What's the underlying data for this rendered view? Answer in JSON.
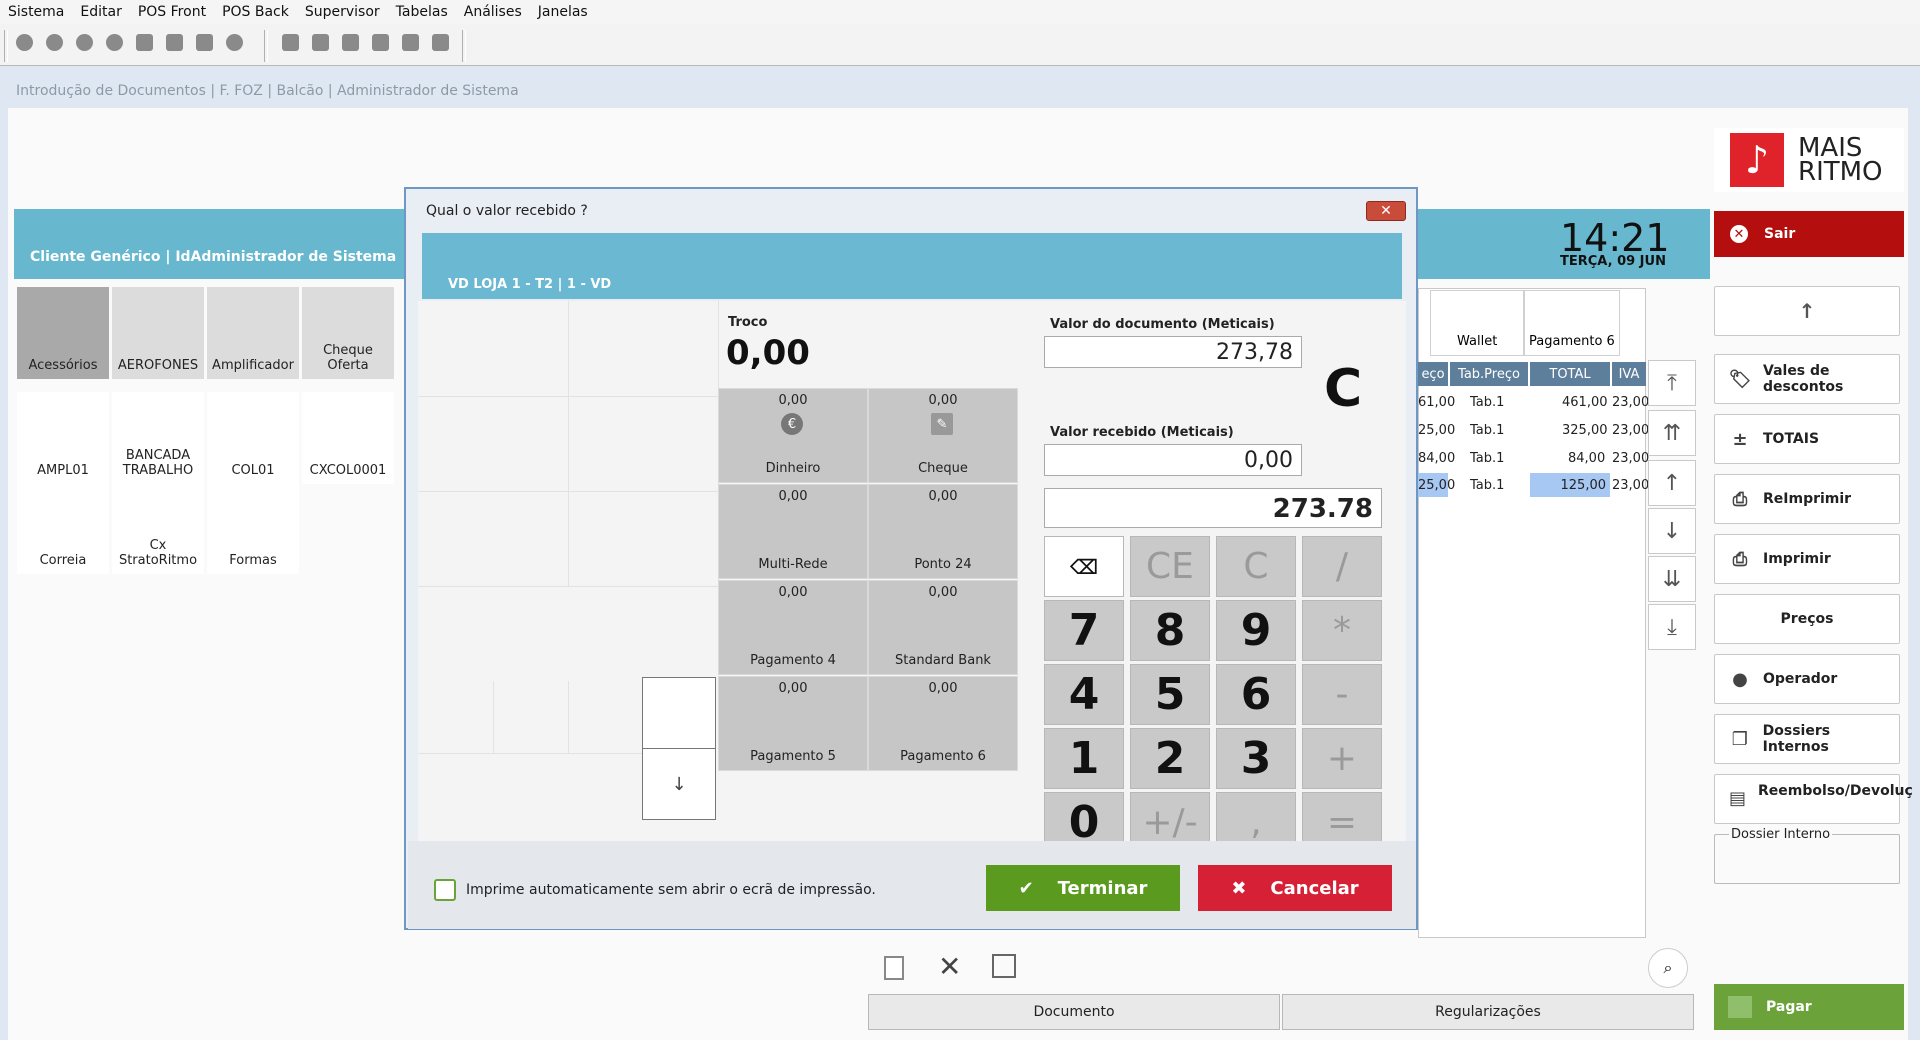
{
  "menu": [
    "Sistema",
    "Editar",
    "POS Front",
    "POS Back",
    "Supervisor",
    "Tabelas",
    "Análises",
    "Janelas"
  ],
  "breadcrumb": "Introdução de Documentos | F. FOZ | Balcão | Administrador de Sistema",
  "client_bar": "Cliente Genérico | IdAdministrador de Sistema",
  "categories_row1": [
    "Acessórios",
    "AEROFONES",
    "Amplificador",
    "Cheque Oferta"
  ],
  "products_row2": [
    "AMPL01",
    "BANCADA TRABALHO",
    "COL01",
    "CXCOL0001"
  ],
  "products_row3": [
    "Correia",
    "Cx StratoRitmo",
    "Formas"
  ],
  "clock": {
    "time": "14:21",
    "date": "TERÇA, 09 JUN"
  },
  "logo": {
    "line1": "MAIS",
    "line2": "RITMO"
  },
  "right_buttons": {
    "sair": "Sair",
    "vales": "Vales de descontos",
    "totais": "TOTAIS",
    "reimprimir": "ReImprimir",
    "imprimir": "Imprimir",
    "precos": "Preços",
    "operador": "Operador",
    "dossiers": "Dossiers Internos",
    "reembolso": "Reembolso/Devoluç",
    "dossier_interno": "Dossier Interno",
    "pagar": "Pagar"
  },
  "table": {
    "col_headers_top": [
      "Wallet",
      "Pagamento 6"
    ],
    "headers": [
      "eço",
      "Tab.Preço",
      "TOTAL",
      "IVA"
    ],
    "rows": [
      {
        "preco": "61,00",
        "tab": "Tab.1",
        "total": "461,00",
        "iva": "23,00"
      },
      {
        "preco": "25,00",
        "tab": "Tab.1",
        "total": "325,00",
        "iva": "23,00"
      },
      {
        "preco": "84,00",
        "tab": "Tab.1",
        "total": "84,00",
        "iva": "23,00"
      },
      {
        "preco": "25,00",
        "tab": "Tab.1",
        "total": "125,00",
        "iva": "23,00"
      }
    ]
  },
  "bottom_tabs": [
    "Documento",
    "Regularizações"
  ],
  "dialog": {
    "title": "Qual o valor recebido ?",
    "header": "VD LOJA 1 - T2 | 1 - VD",
    "troco_label": "Troco",
    "troco_value": "0,00",
    "payments": [
      {
        "value": "0,00",
        "label": "Dinheiro"
      },
      {
        "value": "0,00",
        "label": "Cheque"
      },
      {
        "value": "0,00",
        "label": "Multi-Rede"
      },
      {
        "value": "0,00",
        "label": "Ponto 24"
      },
      {
        "value": "0,00",
        "label": "Pagamento 4"
      },
      {
        "value": "0,00",
        "label": "Standard Bank"
      },
      {
        "value": "0,00",
        "label": "Pagamento 5"
      },
      {
        "value": "0,00",
        "label": "Pagamento 6"
      }
    ],
    "valor_documento_label": "Valor do documento (Meticais)",
    "valor_documento": "273,78",
    "valor_recebido_label": "Valor recebido (Meticais)",
    "valor_recebido": "0,00",
    "big_letter": "C",
    "display": "273.78",
    "keys": [
      "⌫",
      "CE",
      "C",
      "/",
      "7",
      "8",
      "9",
      "*",
      "4",
      "5",
      "6",
      "-",
      "1",
      "2",
      "3",
      "+",
      "0",
      "+/-",
      ",",
      "="
    ],
    "checkbox_label": "Imprime automaticamente sem abrir o ecrã de impressão.",
    "ok": "Terminar",
    "cancel": "Cancelar"
  }
}
